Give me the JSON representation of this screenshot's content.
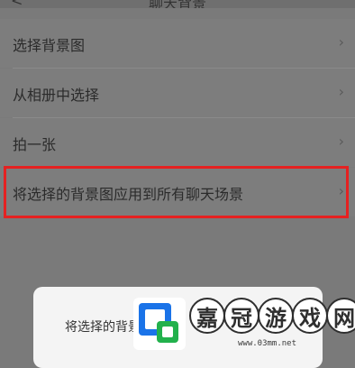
{
  "header": {
    "title": "聊天背景",
    "back_icon": "chevron-left-icon"
  },
  "menu": {
    "items": [
      {
        "label": "选择背景图"
      },
      {
        "label": "从相册中选择"
      },
      {
        "label": "拍一张"
      },
      {
        "label": "将选择的背景图应用到所有聊天场景",
        "highlighted": true
      }
    ],
    "highlight_color": "#e52121"
  },
  "dialog": {
    "message": "将选择的背景图应用到所有聊天场景"
  },
  "watermark": {
    "chars": [
      "嘉",
      "冠",
      "游",
      "戏",
      "网"
    ],
    "url": "www.03mm.net",
    "logo_colors": [
      "#1a73e8",
      "#22b14c"
    ]
  }
}
